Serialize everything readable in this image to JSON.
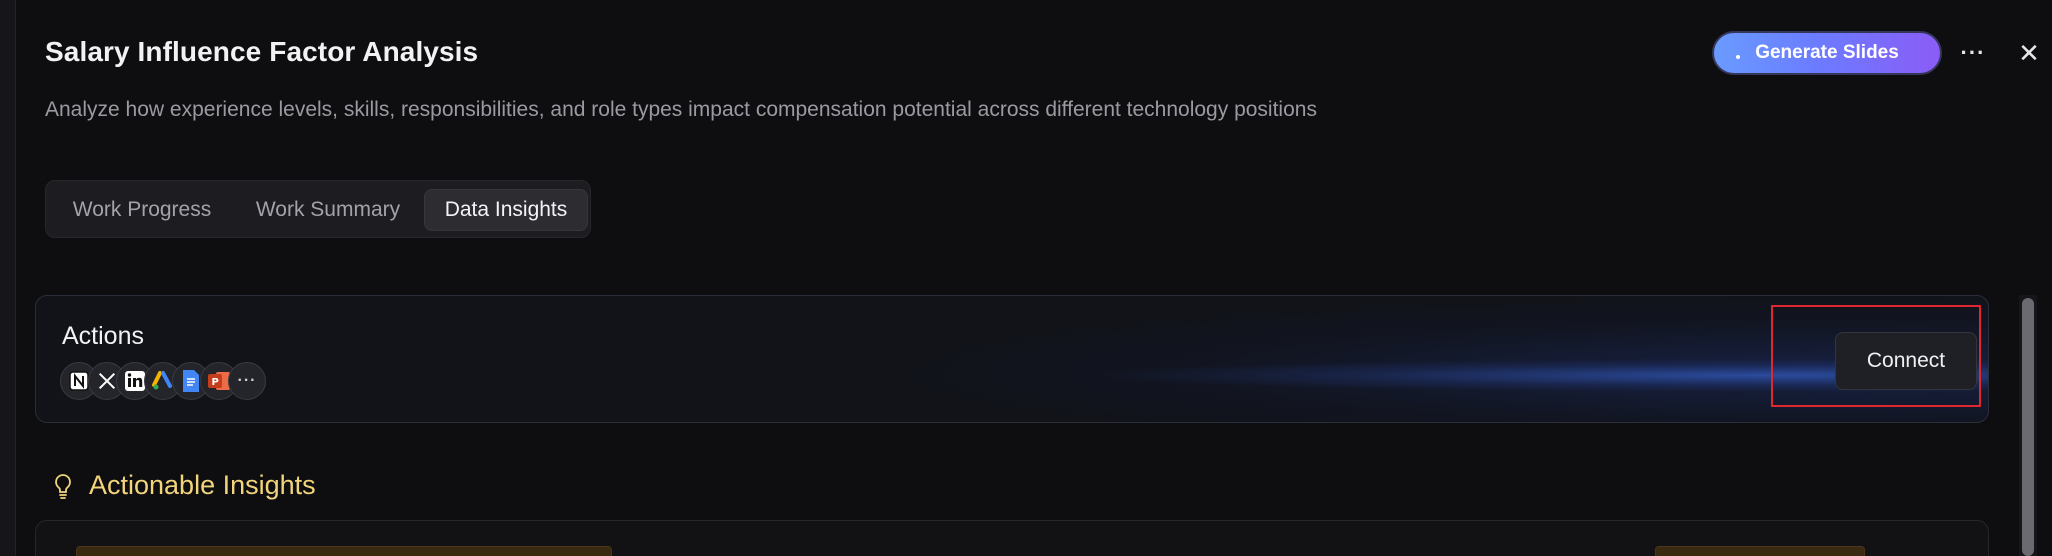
{
  "header": {
    "title": "Salary Influence Factor Analysis",
    "subtitle": "Analyze how experience levels, skills, responsibilities, and role types impact compensation potential across different technology positions",
    "generate_button_label": "Generate Slides",
    "more_icon": "more-horizontal-icon",
    "close_icon": "close-icon"
  },
  "tabs": [
    {
      "label": "Work Progress",
      "active": false
    },
    {
      "label": "Work Summary",
      "active": false
    },
    {
      "label": "Data Insights",
      "active": true
    }
  ],
  "actions": {
    "label": "Actions",
    "connect_label": "Connect",
    "apps": [
      {
        "name": "notion-icon",
        "glyph": "N"
      },
      {
        "name": "x-twitter-icon",
        "glyph": "X"
      },
      {
        "name": "linkedin-icon",
        "glyph": "in"
      },
      {
        "name": "google-ads-icon",
        "glyph": "A"
      },
      {
        "name": "google-docs-icon",
        "glyph": "≡"
      },
      {
        "name": "powerpoint-icon",
        "glyph": "P"
      },
      {
        "name": "more-apps-icon",
        "glyph": "···"
      }
    ]
  },
  "insights": {
    "title": "Actionable Insights"
  },
  "colors": {
    "accent_gradient_start": "#6a9bff",
    "accent_gradient_end": "#8a5cf6",
    "insights_title": "#f2d47a",
    "highlight_border": "#e0262e"
  }
}
